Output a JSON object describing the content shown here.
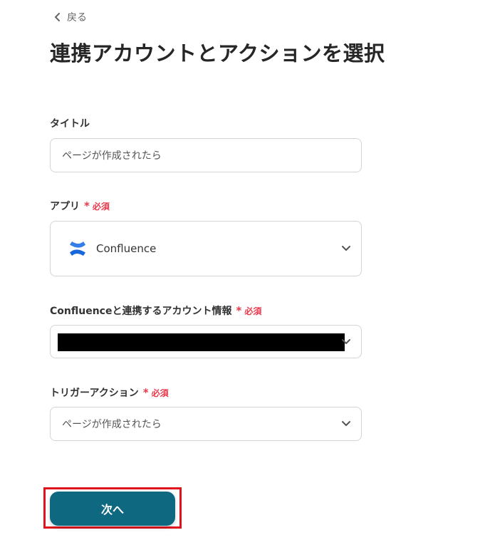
{
  "header": {
    "back_label": "戻る",
    "title": "連携アカウントとアクションを選択"
  },
  "form": {
    "title_field": {
      "label": "タイトル",
      "value": "ページが作成されたら"
    },
    "app_field": {
      "label": "アプリ",
      "required_mark": "*",
      "required_text": "必須",
      "value": "Confluence",
      "icon": "confluence-logo"
    },
    "account_field": {
      "label": "Confluenceと連携するアカウント情報",
      "required_mark": "*",
      "required_text": "必須"
    },
    "trigger_field": {
      "label": "トリガーアクション",
      "required_mark": "*",
      "required_text": "必須",
      "value": "ページが作成されたら"
    }
  },
  "footer": {
    "next_label": "次へ"
  },
  "colors": {
    "primary": "#0e6880",
    "required": "#e8394c",
    "highlight": "#e0131d",
    "confluence_blue": "#1868db"
  }
}
